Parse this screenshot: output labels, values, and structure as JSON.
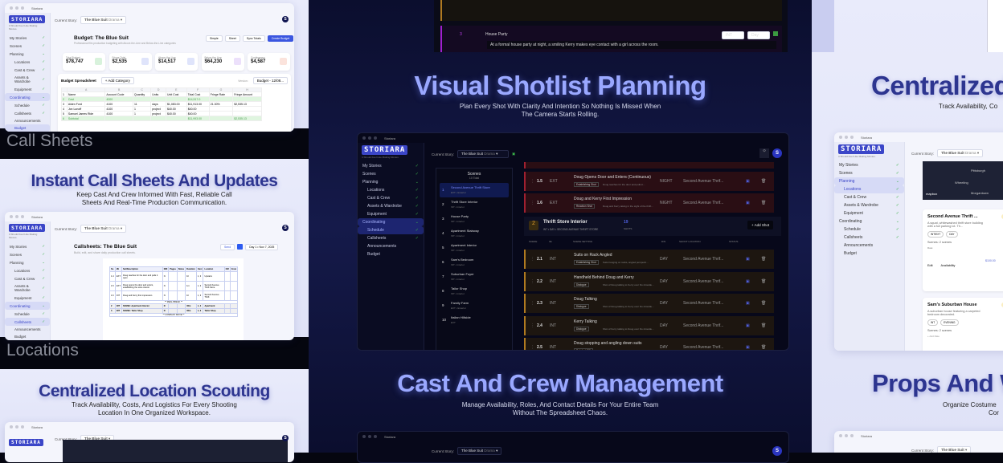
{
  "brand": {
    "logo": "STORIARA",
    "tagline": "It Should Feel Like Making Movies.",
    "window_title": "Storiara",
    "current_story_label": "Current Story:",
    "story": "The Blue Suit",
    "genre": "Drama",
    "avatar": "S"
  },
  "nav": {
    "my_stories": "My Stories",
    "scenes": "Scenes",
    "planning": "Planning",
    "locations": "Locations",
    "cast_crew": "Cast & Crew",
    "assets": "Assets & Wardrobe",
    "equipment": "Equipment",
    "coordinating": "Coordinating",
    "schedule": "Schedule",
    "callsheets": "Callsheets",
    "announcements": "Announcements",
    "budget": "Budget"
  },
  "sections": {
    "call_sheets_label": "Call Sheets",
    "locations_label": "Locations",
    "callsheets_title": "Instant Call Sheets And Updates",
    "callsheets_sub": "Keep Cast And Crew Informed With Fast, Reliable Call Sheets And Real-Time Production Communication.",
    "location_title": "Centralized Location Scouting",
    "location_sub": "Track Availability, Costs, And Logistics For Every Shooting Location In One Organized Workspace.",
    "shotlist_title": "Visual Shotlist Planning",
    "shotlist_sub": "Plan Every Shot With Clarity And Intention So Nothing Is Missed When The Camera Starts Rolling.",
    "cast_title": "Cast And Crew Management",
    "cast_sub": "Manage Availability, Roles, And Contact Details For Your Entire Team Without The Spreadsheet Chaos.",
    "right_title": "Centralized",
    "right_sub": "Track Availability, Co",
    "props_title": "Props And W",
    "props_sub": "Organize Costume",
    "props_sub2": "Cor"
  },
  "budget": {
    "title": "Budget: The Blue Suit",
    "subtitle": "Professional film production budgeting with Above-the-Line and Below-the-Line categories",
    "buttons": [
      "Simple",
      "Sheet",
      "Sync Totals",
      "Create Budget"
    ],
    "stats": [
      {
        "label": "Total Budget",
        "value": "$78,747"
      },
      {
        "label": "Fringe Total",
        "value": "$2,535"
      },
      {
        "label": "Above-the-Line",
        "value": "$14,517"
      },
      {
        "label": "Below-the-Line",
        "value": "$64,230"
      },
      {
        "label": "Contingency",
        "value": "$4,587"
      }
    ],
    "sheet_title": "Budget Spreadsheet",
    "add_category": "Add Category",
    "version_label": "Version:",
    "version": "Budget - 12/08...",
    "columns": [
      "",
      "A",
      "B",
      "C",
      "D",
      "E",
      "F",
      "G",
      "H"
    ],
    "rows": [
      [
        "1",
        "Name",
        "Account Code",
        "Quantity",
        "Units",
        "Unit Cost",
        "Total Cost",
        "Fringe Rate",
        "Fringe Amount"
      ],
      [
        "2",
        "Cast",
        "4000",
        "",
        "",
        "",
        "$14,517.0",
        "",
        ""
      ],
      [
        "3",
        "Aiden Ford",
        "4100",
        "11",
        "days",
        "$1,083.00",
        "$11,913.00",
        "21.30%",
        "$2,535.13"
      ],
      [
        "4",
        "Jon Lunoff",
        "4100",
        "1",
        "project",
        "$40.00",
        "$40.00",
        "",
        ""
      ],
      [
        "5",
        "Samuel James Ride",
        "4100",
        "1",
        "project",
        "$40.00",
        "$40.00",
        "",
        ""
      ],
      [
        "6",
        "Subtotal",
        "",
        "",
        "",
        "",
        "$11,993.00",
        "",
        "$2,535.13"
      ]
    ]
  },
  "callsheet": {
    "title": "Callsheets: The Blue Suit",
    "subtitle": "Build, edit, and share daily production call sheets.",
    "send": "Send",
    "date": "Day 1 • Nov 7, 2025",
    "headers": [
      "Sc.",
      "I/E",
      "Set/Description",
      "D/N",
      "Pages",
      "Notes",
      "Duration",
      "Cast",
      "Location",
      "CM",
      "Crew"
    ],
    "rows": [
      [
        "1.4",
        "EXT",
        "Doug reaches for the door and pulls it open",
        "N",
        "",
        "",
        "1h",
        "1, 3",
        "Upstairs"
      ],
      [
        "1.5",
        "EXT",
        "Doug opens the door and enters, establishing the store interior",
        "N",
        "",
        "",
        "1m",
        "1, 3",
        "Second Avenue Thrift Store"
      ],
      [
        "1.6",
        "INT",
        "Doug and Kerry first impression",
        "N",
        "",
        "",
        "1h",
        "1, 3",
        "Second Avenue Thrift"
      ],
      [
        "2",
        "INT",
        "SCENE: Apartment Interior",
        "D",
        "",
        "",
        "30m",
        "1, 4",
        "Apartment"
      ],
      [
        "3",
        "INT",
        "SCENE: Tailor Shop",
        "D",
        "",
        "",
        "30m",
        "1, 2",
        "Tailor Shop"
      ]
    ],
    "break1": "** MEAL BREAK **",
    "break2": "** COMPANY MOVE **"
  },
  "shotlist_top": {
    "scene_no": "3",
    "title": "House Party",
    "ie": "INT",
    "dn": "Day",
    "desc": "At a formal house party at night, a smiling Kerry makes eye contact with a girl across the room."
  },
  "schedule": {
    "scenes_title": "Scenes",
    "scenes_total": "10 Total",
    "scenes": [
      {
        "n": "1",
        "name": "Second Avenue Thrift Store",
        "meta": "EXT • Exterior"
      },
      {
        "n": "2",
        "name": "Thrift Store Interior",
        "meta": "INT • Interior"
      },
      {
        "n": "3",
        "name": "House Party",
        "meta": "INT • Interior"
      },
      {
        "n": "4",
        "name": "Apartment Stairway",
        "meta": "INT • Interior"
      },
      {
        "n": "5",
        "name": "Apartment Interior",
        "meta": "INT • Interior"
      },
      {
        "n": "6",
        "name": "Sam's Bedroom",
        "meta": "INT • Interior"
      },
      {
        "n": "7",
        "name": "Suburban Foyer",
        "meta": "INT • Interior"
      },
      {
        "n": "8",
        "name": "Tailor Shop",
        "meta": "INT • Interior"
      },
      {
        "n": "9",
        "name": "Family Farm",
        "meta": "EXT • Exterior"
      },
      {
        "n": "10",
        "name": "Italian Hillside",
        "meta": "EXT"
      }
    ],
    "group": {
      "n": "2",
      "title": "Thrift Store Interior",
      "meta": "INT • DAY • SECOND AVENUE THRIFT STORE",
      "count": "19",
      "count_label": "SHOTS",
      "add_shot": "Add Shot"
    },
    "col_headers": [
      "SCENE",
      "I/E",
      "SCENE SETTING",
      "D/N",
      "SHOOT LOCATION",
      "STATUS"
    ],
    "shots_red": [
      {
        "n": "1.5",
        "ie": "EXT",
        "title": "Doug Opens Door and Enters (Continuous)",
        "type": "Establishing Shot",
        "desc": "Doug reaches for the door and pulls it...",
        "dn": "NIGHT",
        "loc": "Second Avenue Thrif..."
      },
      {
        "n": "1.6",
        "ie": "EXT",
        "title": "Doug and Kerry First Impression",
        "type": "Reaction Shot",
        "desc": "Doug and Kerry taking in the sight of the thrift...",
        "dn": "NIGHT",
        "loc": "Second Avenue Thrif..."
      }
    ],
    "shots": [
      {
        "n": "2.1",
        "ie": "INT",
        "title": "Suits on Rack Angled",
        "type": "Establishing Shot",
        "desc": "Suits hanging on racks, angled perspecti...",
        "dn": "DAY",
        "loc": "Second Avenue Thrif..."
      },
      {
        "n": "2.2",
        "ie": "INT",
        "title": "Handheld Behind Doug and Kerry",
        "type": "Dialogue",
        "desc": "Shot of Doug talking to Kerry over his shoulde...",
        "dn": "DAY",
        "loc": "Second Avenue Thrif..."
      },
      {
        "n": "2.3",
        "ie": "INT",
        "title": "Doug Talking",
        "type": "Dialogue",
        "desc": "Shot of Doug talking to Kerry over his shoulde...",
        "dn": "DAY",
        "loc": "Second Avenue Thrif..."
      },
      {
        "n": "2.4",
        "ie": "INT",
        "title": "Kerry Talking",
        "type": "Dialogue",
        "desc": "Shot of Kerry talking to Doug over his shoulde...",
        "dn": "DAY",
        "loc": "Second Avenue Thrif..."
      },
      {
        "n": "2.5",
        "ie": "INT",
        "title": "Doug stopping and angling down suits",
        "type": "Subshot (15)",
        "desc": "ANGLE: doesn't imagine a hundred suits along...",
        "dn": "DAY",
        "loc": "Second Avenue Thrif..."
      }
    ]
  },
  "locations": {
    "map_labels": [
      "Pittsburgh",
      "Wheeling",
      "Morgantown",
      "mapbox"
    ],
    "cards": [
      {
        "name": "Second Avenue Thrift ...",
        "badge": "Needs",
        "desc": "A squat, whitewashed thrift store building with a full parking lot. Th...",
        "tags": [
          "INT/EXT",
          "DAY"
        ],
        "scenes": "Scenes: 2 scenes",
        "rate_label": "Rate:",
        "rate": "$100.00",
        "edit": "Edit",
        "availability": "Availability"
      },
      {
        "name": "Sam's Suburban House",
        "badge": "Needs",
        "desc": "A suburban house featuring a carpeted bedroom decorated.",
        "tags": [
          "INT",
          "EVENING"
        ],
        "scenes": "Scenes: 2 scenes",
        "add_rate": "+ Add Rate"
      }
    ]
  },
  "colors": {
    "accent": "#3b46c8",
    "heading_light": "#2d3590",
    "heading_dark": "#9aa8ff",
    "success": "#3bb34a"
  }
}
